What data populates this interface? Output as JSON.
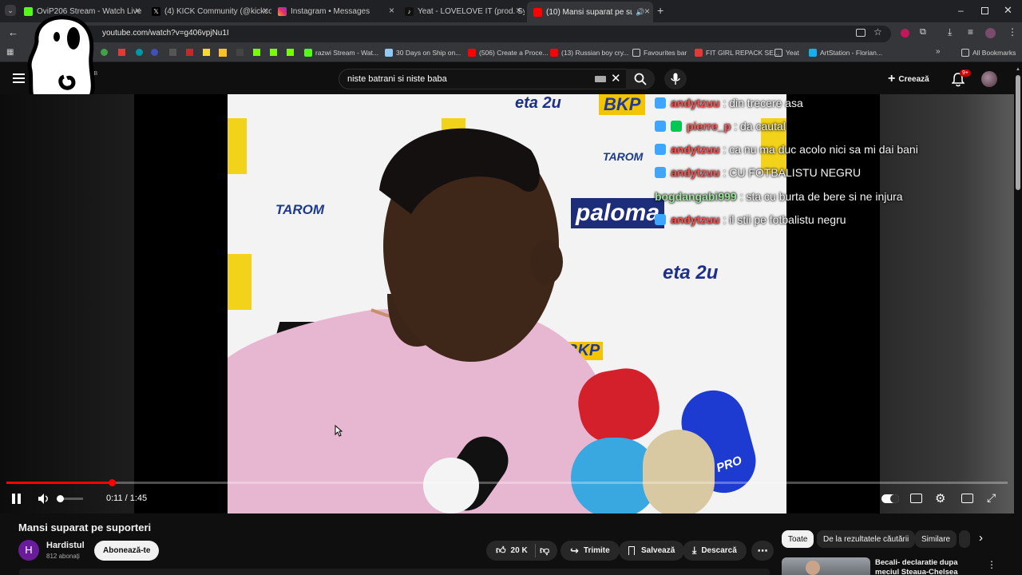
{
  "browser": {
    "tabs": [
      {
        "title": "OviP206 Stream - Watch Live o",
        "favicon_color": "#53fc18"
      },
      {
        "title": "(4) KICK Community (@kickcom",
        "favicon_color": "#000000"
      },
      {
        "title": "Instagram • Messages",
        "favicon_color": "#e1306c"
      },
      {
        "title": "Yeat - LOVELOVE IT (prod. Synth",
        "favicon_color": "#111111"
      },
      {
        "title": "(10) Mansi suparat pe supo",
        "favicon_color": "#ff0000"
      }
    ],
    "new_tab_label": "+",
    "url": "youtube.com/watch?v=g406vpjNu1I",
    "bookmarks": [
      {
        "label": "razwi Stream - Wat...",
        "icon": "kick-icon"
      },
      {
        "label": "30 Days on Ship on...",
        "icon": "ship-icon"
      },
      {
        "label": "(506) Create a Proce...",
        "icon": "youtube-icon"
      },
      {
        "label": "(13) Russian boy cry...",
        "icon": "youtube-icon"
      },
      {
        "label": "Favourites bar",
        "icon": "folder-icon"
      },
      {
        "label": "FIT GIRL REPACK SE...",
        "icon": "fitgirl-icon"
      },
      {
        "label": "Yeat",
        "icon": "folder-icon"
      },
      {
        "label": "ArtStation - Florian...",
        "icon": "artstation-icon"
      }
    ],
    "all_bookmarks_label": "All Bookmarks"
  },
  "youtube": {
    "country_code": "GB",
    "search_value": "niste batrani si niste baba",
    "create_label": "Creează",
    "notifications_badge": "9+"
  },
  "video_overlay": {
    "sponsors": [
      "eta 2u",
      "BKP",
      "TAROM",
      "paloma",
      "eta 2u",
      "TAROM",
      "BKP",
      "PRO"
    ],
    "chat": [
      {
        "user": "andytzuu",
        "message": ": din trecere asa",
        "color": "#ff4d4d"
      },
      {
        "user": "pierre_p",
        "message": ": da cautal",
        "color": "#ff5a5a"
      },
      {
        "user": "andytzuu",
        "message": ": ca nu ma duc acolo nici sa mi dai bani",
        "color": "#ff4d4d"
      },
      {
        "user": "andytzuu",
        "message": ": CU FOTBALISTU NEGRU",
        "color": "#ff4d4d"
      },
      {
        "user": "bogdangabi999",
        "message": ": sta cu burta de bere si ne injura",
        "color": "#9be39b"
      },
      {
        "user": "andytzuu",
        "message": ": il stii pe fotbalistu negru",
        "color": "#ff4d4d"
      }
    ]
  },
  "player": {
    "time": "0:11 / 1:45",
    "progress": 0.105,
    "volume": 0.0
  },
  "video": {
    "title": "Mansi suparat pe suporteri",
    "channel": "Hardistul",
    "channel_initial": "H",
    "subscribers": "812 abonați",
    "subscribe_label": "Abonează-te",
    "likes": "20 K",
    "share_label": "Trimite",
    "save_label": "Salvează",
    "download_label": "Descarcă"
  },
  "sidebar": {
    "chips": [
      "Toate",
      "De la rezultatele căutării",
      "Similare"
    ],
    "next_video_title": "Becali- declaratie dupa meciul Steaua-Chelsea"
  }
}
